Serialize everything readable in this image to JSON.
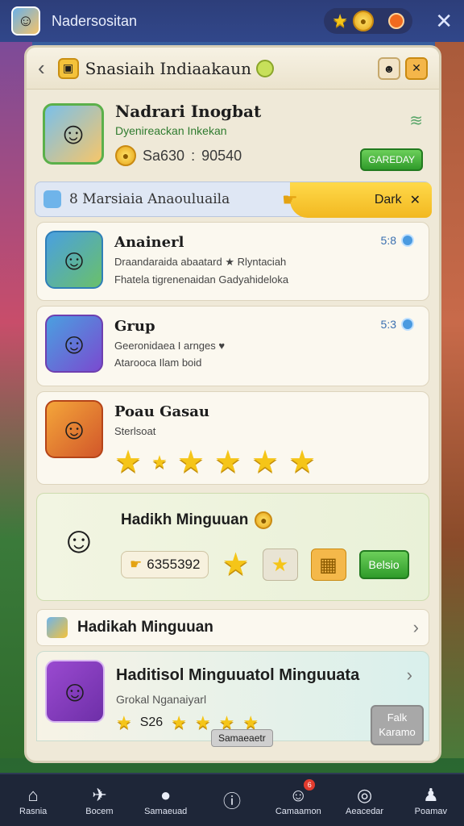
{
  "topbar": {
    "title": "Nadersositan",
    "close_label": "✕"
  },
  "panel": {
    "header_title": "Snasiaih Indiaakaun",
    "back_label": "‹"
  },
  "profile": {
    "name": "Nadrari Inogbat",
    "subtitle": "Dyenireackan Inkekan",
    "score_left": "Sa630",
    "score_sep": ":",
    "score_right": "90540",
    "button_label": "GAREDAY"
  },
  "section_bar": {
    "label": "8 Marsiaia Anaouluaila",
    "pill_label": "Dark",
    "pill_close": "✕"
  },
  "cards": [
    {
      "title": "Anainerl",
      "line1": "Draandaraida abaatard ★ Rlyntaciah",
      "line2": "Fhatela tigrenenaidan Gadyahideloka",
      "meta": "5:8"
    },
    {
      "title": "Grup",
      "line1": "Geeronidaea I arnges ♥",
      "line2": "Atarooca Ilam boid",
      "meta": "5:3"
    },
    {
      "title": "Poau Gasau",
      "line1": "Sterlsoat"
    }
  ],
  "weekly": {
    "title": "Hadikh Minguuan",
    "count": "6355392",
    "button_label": "Belsio"
  },
  "row_link": {
    "label": "Hadikah Minguuan"
  },
  "bottom_card": {
    "title": "Haditisol Minguuatol Minguuata",
    "subtitle": "Grokal Nganaiyarl",
    "count": "S26",
    "tag": "Samaeaetr",
    "gray_button": "Falk Karamo"
  },
  "nav": [
    {
      "label": "Rasnia",
      "icon": "home-icon"
    },
    {
      "label": "Bocem",
      "icon": "plane-icon"
    },
    {
      "label": "Samaeuad",
      "icon": "person-icon"
    },
    {
      "label": "",
      "icon": "info-icon"
    },
    {
      "label": "Camaamon",
      "icon": "chat-icon",
      "badge": "6"
    },
    {
      "label": "Aeacedar",
      "icon": "target-icon"
    },
    {
      "label": "Poamav",
      "icon": "profile-icon"
    }
  ]
}
